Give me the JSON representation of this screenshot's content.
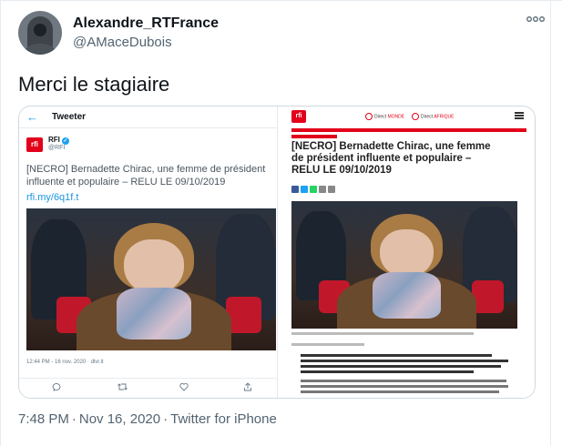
{
  "tweet": {
    "display_name": "Alexandre_RTFrance",
    "handle": "@AMaceDubois",
    "text": "Merci le stagiaire",
    "more_icon": "more-horizontal-icon",
    "time": "7:48 PM",
    "date": "Nov 16, 2020",
    "source": "Twitter for iPhone"
  },
  "left_screenshot": {
    "app_title": "Tweeter",
    "back_icon": "back-arrow-icon",
    "account_name": "RFI",
    "account_handle": "@RFI",
    "logo_text": "rfi",
    "body": "[NECRO] Bernadette Chirac, une femme de président influente et populaire – RELU LE 09/10/2019",
    "link": "rfi.my/6q1f.t",
    "meta": "12:44 PM - 16 nov. 2020 · dlvr.it"
  },
  "right_screenshot": {
    "logo_text": "rfi",
    "live_label": "Direct",
    "live_monde": "MONDE",
    "live_afrique": "AFRIQUE",
    "headline": "[NECRO] Bernadette Chirac, une femme de président influente et populaire – RELU LE 09/10/2019"
  },
  "colors": {
    "brand_red": "#e2001a",
    "twitter_blue": "#1da1f2",
    "text_secondary": "#536471"
  }
}
